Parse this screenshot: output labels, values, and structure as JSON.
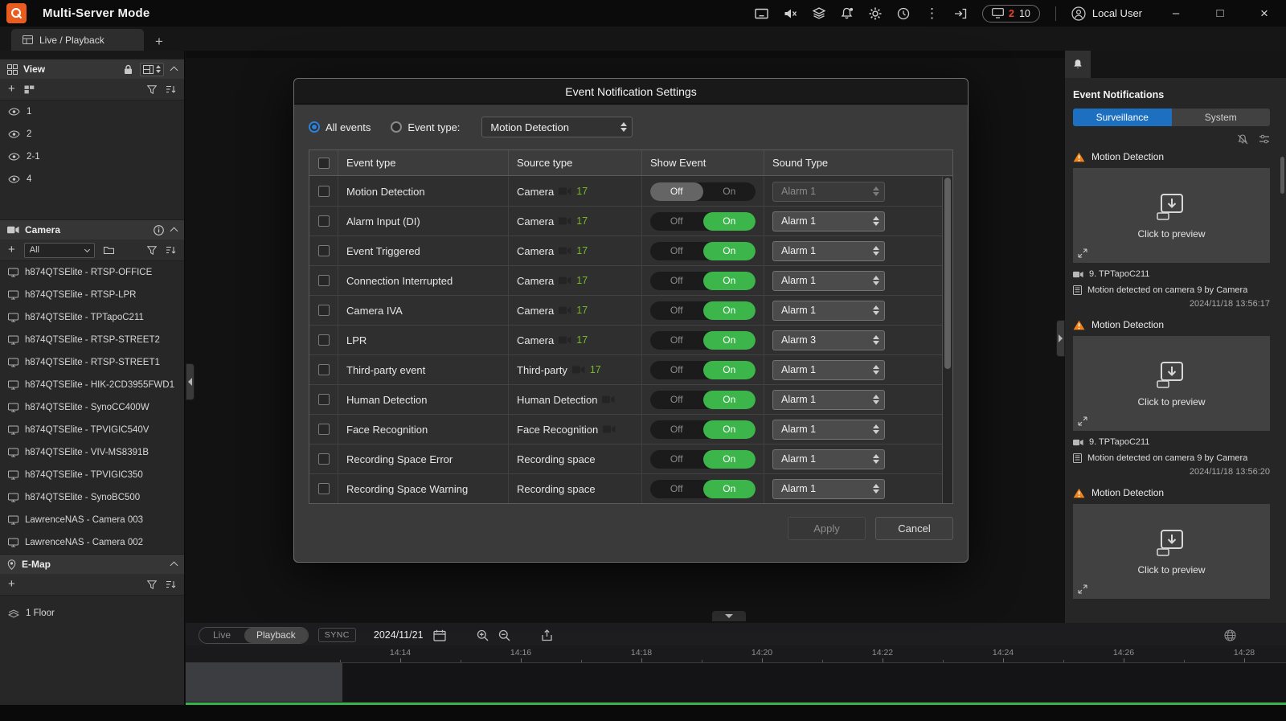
{
  "icons": {
    "add": "+",
    "kebab": "⋮",
    "minimize": "–",
    "maximize": "□",
    "close": "×"
  },
  "titlebar": {
    "title": "Multi-Server Mode",
    "badge": {
      "alert": "2",
      "count": "10"
    },
    "user_label": "Local User"
  },
  "tabbar": {
    "active_tab": "Live / Playback"
  },
  "sidebar": {
    "view": {
      "title": "View",
      "items": [
        {
          "label": "1"
        },
        {
          "label": "2"
        },
        {
          "label": "2-1"
        },
        {
          "label": "4"
        }
      ]
    },
    "camera": {
      "title": "Camera",
      "filter_value": "All",
      "items": [
        "h874QTSElite - RTSP-OFFICE",
        "h874QTSElite - RTSP-LPR",
        "h874QTSElite - TPTapoC211",
        "h874QTSElite - RTSP-STREET2",
        "h874QTSElite - RTSP-STREET1",
        "h874QTSElite - HIK-2CD3955FWD1",
        "h874QTSElite - SynoCC400W",
        "h874QTSElite - TPVIGIC540V",
        "h874QTSElite - VIV-MS8391B",
        "h874QTSElite - TPVIGIC350",
        "h874QTSElite - SynoBC500",
        "LawrenceNAS - Camera 003",
        "LawrenceNAS - Camera 002"
      ]
    },
    "emap": {
      "title": "E-Map",
      "items": [
        "1 Floor"
      ]
    }
  },
  "modal": {
    "title": "Event Notification Settings",
    "filter": {
      "all_events": "All events",
      "event_type_label": "Event type:",
      "event_type_value": "Motion Detection"
    },
    "toggle": {
      "off": "Off",
      "on": "On"
    },
    "table": {
      "headers": [
        "Event type",
        "Source type",
        "Show Event",
        "Sound Type"
      ],
      "rows": [
        {
          "event": "Motion Detection",
          "source": "Camera",
          "count": "17",
          "has_camera_icon": true,
          "show_event": "off",
          "sound": "Alarm 1",
          "sound_enabled": false
        },
        {
          "event": "Alarm Input (DI)",
          "source": "Camera",
          "count": "17",
          "has_camera_icon": true,
          "show_event": "on",
          "sound": "Alarm 1",
          "sound_enabled": true
        },
        {
          "event": "Event Triggered",
          "source": "Camera",
          "count": "17",
          "has_camera_icon": true,
          "show_event": "on",
          "sound": "Alarm 1",
          "sound_enabled": true
        },
        {
          "event": "Connection Interrupted",
          "source": "Camera",
          "count": "17",
          "has_camera_icon": true,
          "show_event": "on",
          "sound": "Alarm 1",
          "sound_enabled": true
        },
        {
          "event": "Camera IVA",
          "source": "Camera",
          "count": "17",
          "has_camera_icon": true,
          "show_event": "on",
          "sound": "Alarm 1",
          "sound_enabled": true
        },
        {
          "event": "LPR",
          "source": "Camera",
          "count": "17",
          "has_camera_icon": true,
          "show_event": "on",
          "sound": "Alarm 3",
          "sound_enabled": true
        },
        {
          "event": "Third-party event",
          "source": "Third-party",
          "count": "17",
          "has_camera_icon": true,
          "show_event": "on",
          "sound": "Alarm 1",
          "sound_enabled": true
        },
        {
          "event": "Human Detection",
          "source": "Human Detection",
          "count": "",
          "has_camera_icon": true,
          "show_event": "on",
          "sound": "Alarm 1",
          "sound_enabled": true
        },
        {
          "event": "Face Recognition",
          "source": "Face Recognition",
          "count": "",
          "has_camera_icon": true,
          "show_event": "on",
          "sound": "Alarm 1",
          "sound_enabled": true
        },
        {
          "event": "Recording Space Error",
          "source": "Recording space",
          "count": "",
          "has_camera_icon": false,
          "show_event": "on",
          "sound": "Alarm 1",
          "sound_enabled": true
        },
        {
          "event": "Recording Space Warning",
          "source": "Recording space",
          "count": "",
          "has_camera_icon": false,
          "show_event": "on",
          "sound": "Alarm 1",
          "sound_enabled": true
        }
      ]
    },
    "buttons": {
      "apply": "Apply",
      "cancel": "Cancel"
    }
  },
  "notifications": {
    "panel_title": "Event Notifications",
    "tabs": [
      {
        "label": "Surveillance",
        "active": true
      },
      {
        "label": "System",
        "active": false
      }
    ],
    "cards": [
      {
        "type": "Motion Detection",
        "preview_label": "Click to preview",
        "camera": "9. TPTapoC211",
        "message": "Motion detected on camera 9 by Camera",
        "timestamp": "2024/11/18 13:56:17"
      },
      {
        "type": "Motion Detection",
        "preview_label": "Click to preview",
        "camera": "9. TPTapoC211",
        "message": "Motion detected on camera 9 by Camera",
        "timestamp": "2024/11/18 13:56:20"
      },
      {
        "type": "Motion Detection",
        "preview_label": "Click to preview"
      }
    ]
  },
  "timeline": {
    "mode_live": "Live",
    "mode_playback": "Playback",
    "sync": "SYNC",
    "date": "2024/11/21",
    "ticks": [
      "14:14",
      "14:16",
      "14:18",
      "14:20",
      "14:22",
      "14:24",
      "14:26",
      "14:28"
    ]
  },
  "colors": {
    "accent_blue": "#1d6fc0",
    "toggle_on_green": "#3cb54a",
    "timeline_green": "#36b34a",
    "warning_orange": "#ef8318",
    "brand_orange": "#e85d1f",
    "camera_count_green": "#76b82a"
  }
}
